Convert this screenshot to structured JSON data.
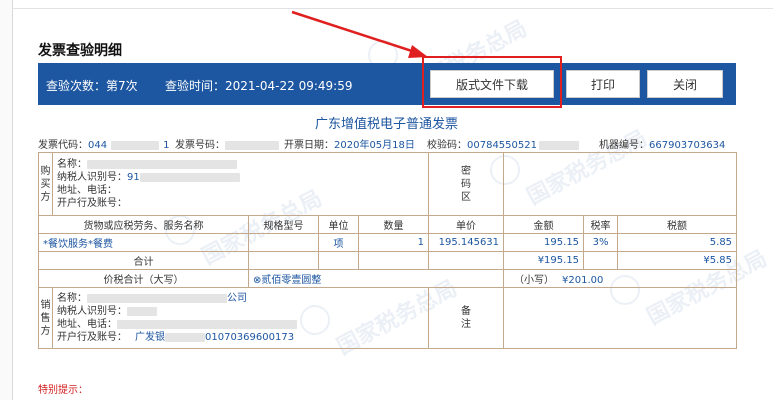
{
  "page": {
    "heading": "发票查验明细",
    "watermark_text": "国家税务总局"
  },
  "bar": {
    "check_count_label": "查验次数：",
    "check_count_value": "第7次",
    "check_time_label": "查验时间：",
    "check_time_value": "2021-04-22 09:49:59"
  },
  "buttons": {
    "download": "版式文件下载",
    "print": "打印",
    "close": "关闭"
  },
  "invoice": {
    "title": "广东增值税电子普通发票",
    "code_label": "发票代码：",
    "code_value_a": "044",
    "code_value_b": "1",
    "number_label": "发票号码：",
    "date_label": "开票日期：",
    "date_value": "2020年05月18日",
    "check_code_label": "校验码：",
    "check_code_value": "00784550521",
    "machine_label": "机器编号：",
    "machine_value": "667903703634"
  },
  "buyer": {
    "side_label": "购买方",
    "name_label": "名称：",
    "tax_id_label": "纳税人识别号：",
    "tax_id_value": "91",
    "address_label": "地址、电话：",
    "bank_label": "开户行及账号：",
    "cipher_label": "密码区"
  },
  "items": {
    "headers": {
      "name": "货物或应税劳务、服务名称",
      "spec": "规格型号",
      "unit": "单位",
      "qty": "数量",
      "price": "单价",
      "amount": "金额",
      "rate": "税率",
      "tax": "税额"
    },
    "rows": [
      {
        "name": "*餐饮服务*餐费",
        "spec": "",
        "unit": "项",
        "qty": "1",
        "price": "195.145631",
        "amount": "195.15",
        "rate": "3%",
        "tax": "5.85"
      }
    ],
    "subtotal_label": "合计",
    "subtotal_amount": "¥195.15",
    "subtotal_tax": "¥5.85"
  },
  "total": {
    "label": "价税合计（大写）",
    "words": "⊗贰佰零壹圆整",
    "small_label": "（小写）",
    "small_value": "¥201.00"
  },
  "seller": {
    "side_label": "销售方",
    "name_label": "名称：",
    "name_partial": "公司",
    "tax_id_label": "纳税人识别号：",
    "address_label": "地址、电话：",
    "bank_label": "开户行及账号：",
    "bank_prefix": "广发银",
    "bank_suffix": "01070369600173",
    "remarks_label": "备注"
  },
  "special_notice": "特别提示："
}
